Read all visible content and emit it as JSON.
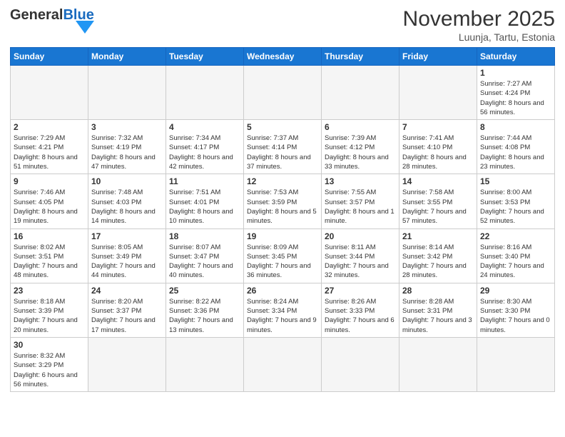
{
  "header": {
    "logo_general": "General",
    "logo_blue": "Blue",
    "month_title": "November 2025",
    "location": "Luunja, Tartu, Estonia"
  },
  "days_of_week": [
    "Sunday",
    "Monday",
    "Tuesday",
    "Wednesday",
    "Thursday",
    "Friday",
    "Saturday"
  ],
  "weeks": [
    [
      {
        "day": "",
        "info": "",
        "empty": true
      },
      {
        "day": "",
        "info": "",
        "empty": true
      },
      {
        "day": "",
        "info": "",
        "empty": true
      },
      {
        "day": "",
        "info": "",
        "empty": true
      },
      {
        "day": "",
        "info": "",
        "empty": true
      },
      {
        "day": "",
        "info": "",
        "empty": true
      },
      {
        "day": "1",
        "info": "Sunrise: 7:27 AM\nSunset: 4:24 PM\nDaylight: 8 hours\nand 56 minutes."
      }
    ],
    [
      {
        "day": "2",
        "info": "Sunrise: 7:29 AM\nSunset: 4:21 PM\nDaylight: 8 hours\nand 51 minutes."
      },
      {
        "day": "3",
        "info": "Sunrise: 7:32 AM\nSunset: 4:19 PM\nDaylight: 8 hours\nand 47 minutes."
      },
      {
        "day": "4",
        "info": "Sunrise: 7:34 AM\nSunset: 4:17 PM\nDaylight: 8 hours\nand 42 minutes."
      },
      {
        "day": "5",
        "info": "Sunrise: 7:37 AM\nSunset: 4:14 PM\nDaylight: 8 hours\nand 37 minutes."
      },
      {
        "day": "6",
        "info": "Sunrise: 7:39 AM\nSunset: 4:12 PM\nDaylight: 8 hours\nand 33 minutes."
      },
      {
        "day": "7",
        "info": "Sunrise: 7:41 AM\nSunset: 4:10 PM\nDaylight: 8 hours\nand 28 minutes."
      },
      {
        "day": "8",
        "info": "Sunrise: 7:44 AM\nSunset: 4:08 PM\nDaylight: 8 hours\nand 23 minutes."
      }
    ],
    [
      {
        "day": "9",
        "info": "Sunrise: 7:46 AM\nSunset: 4:05 PM\nDaylight: 8 hours\nand 19 minutes."
      },
      {
        "day": "10",
        "info": "Sunrise: 7:48 AM\nSunset: 4:03 PM\nDaylight: 8 hours\nand 14 minutes."
      },
      {
        "day": "11",
        "info": "Sunrise: 7:51 AM\nSunset: 4:01 PM\nDaylight: 8 hours\nand 10 minutes."
      },
      {
        "day": "12",
        "info": "Sunrise: 7:53 AM\nSunset: 3:59 PM\nDaylight: 8 hours\nand 5 minutes."
      },
      {
        "day": "13",
        "info": "Sunrise: 7:55 AM\nSunset: 3:57 PM\nDaylight: 8 hours\nand 1 minute."
      },
      {
        "day": "14",
        "info": "Sunrise: 7:58 AM\nSunset: 3:55 PM\nDaylight: 7 hours\nand 57 minutes."
      },
      {
        "day": "15",
        "info": "Sunrise: 8:00 AM\nSunset: 3:53 PM\nDaylight: 7 hours\nand 52 minutes."
      }
    ],
    [
      {
        "day": "16",
        "info": "Sunrise: 8:02 AM\nSunset: 3:51 PM\nDaylight: 7 hours\nand 48 minutes."
      },
      {
        "day": "17",
        "info": "Sunrise: 8:05 AM\nSunset: 3:49 PM\nDaylight: 7 hours\nand 44 minutes."
      },
      {
        "day": "18",
        "info": "Sunrise: 8:07 AM\nSunset: 3:47 PM\nDaylight: 7 hours\nand 40 minutes."
      },
      {
        "day": "19",
        "info": "Sunrise: 8:09 AM\nSunset: 3:45 PM\nDaylight: 7 hours\nand 36 minutes."
      },
      {
        "day": "20",
        "info": "Sunrise: 8:11 AM\nSunset: 3:44 PM\nDaylight: 7 hours\nand 32 minutes."
      },
      {
        "day": "21",
        "info": "Sunrise: 8:14 AM\nSunset: 3:42 PM\nDaylight: 7 hours\nand 28 minutes."
      },
      {
        "day": "22",
        "info": "Sunrise: 8:16 AM\nSunset: 3:40 PM\nDaylight: 7 hours\nand 24 minutes."
      }
    ],
    [
      {
        "day": "23",
        "info": "Sunrise: 8:18 AM\nSunset: 3:39 PM\nDaylight: 7 hours\nand 20 minutes."
      },
      {
        "day": "24",
        "info": "Sunrise: 8:20 AM\nSunset: 3:37 PM\nDaylight: 7 hours\nand 17 minutes."
      },
      {
        "day": "25",
        "info": "Sunrise: 8:22 AM\nSunset: 3:36 PM\nDaylight: 7 hours\nand 13 minutes."
      },
      {
        "day": "26",
        "info": "Sunrise: 8:24 AM\nSunset: 3:34 PM\nDaylight: 7 hours\nand 9 minutes."
      },
      {
        "day": "27",
        "info": "Sunrise: 8:26 AM\nSunset: 3:33 PM\nDaylight: 7 hours\nand 6 minutes."
      },
      {
        "day": "28",
        "info": "Sunrise: 8:28 AM\nSunset: 3:31 PM\nDaylight: 7 hours\nand 3 minutes."
      },
      {
        "day": "29",
        "info": "Sunrise: 8:30 AM\nSunset: 3:30 PM\nDaylight: 7 hours\nand 0 minutes."
      }
    ],
    [
      {
        "day": "30",
        "info": "Sunrise: 8:32 AM\nSunset: 3:29 PM\nDaylight: 6 hours\nand 56 minutes.",
        "last": true
      },
      {
        "day": "",
        "info": "",
        "empty": true,
        "last": true
      },
      {
        "day": "",
        "info": "",
        "empty": true,
        "last": true
      },
      {
        "day": "",
        "info": "",
        "empty": true,
        "last": true
      },
      {
        "day": "",
        "info": "",
        "empty": true,
        "last": true
      },
      {
        "day": "",
        "info": "",
        "empty": true,
        "last": true
      },
      {
        "day": "",
        "info": "",
        "empty": true,
        "last": true
      }
    ]
  ]
}
